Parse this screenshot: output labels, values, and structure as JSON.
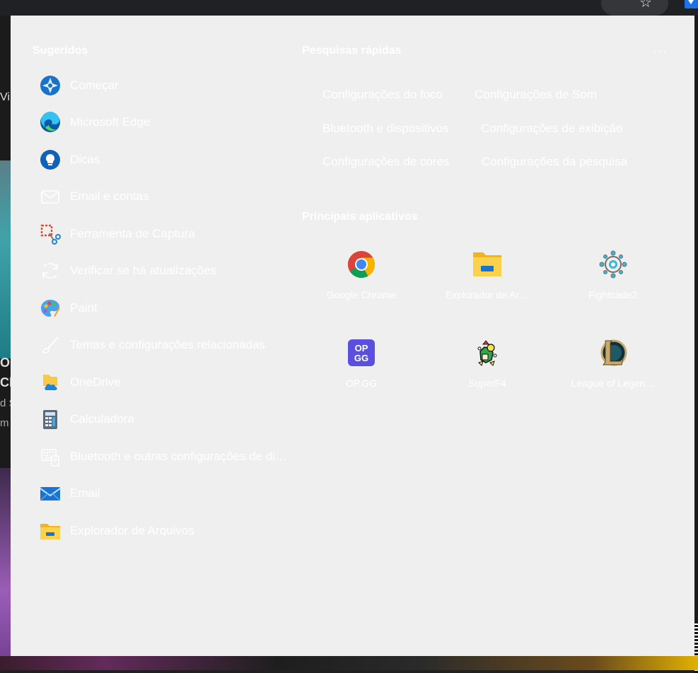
{
  "suggested": {
    "title": "Sugeridos",
    "items": [
      {
        "label": "Começar",
        "icon": "get-started-icon"
      },
      {
        "label": "Microsoft Edge",
        "icon": "edge-icon"
      },
      {
        "label": "Dicas",
        "icon": "tips-icon"
      },
      {
        "label": "Email e contas",
        "icon": "mail-outline-icon"
      },
      {
        "label": "Ferramenta de Captura",
        "icon": "snipping-tool-icon"
      },
      {
        "label": "Verificar se há atualizações",
        "icon": "refresh-icon"
      },
      {
        "label": "Paint",
        "icon": "paint-icon"
      },
      {
        "label": "Temas e configurações relacionadas",
        "icon": "brush-icon"
      },
      {
        "label": "OneDrive",
        "icon": "onedrive-icon"
      },
      {
        "label": "Calculadora",
        "icon": "calculator-icon"
      },
      {
        "label": "Bluetooth e outras configurações de di…",
        "icon": "devices-icon"
      },
      {
        "label": "Email",
        "icon": "mail-app-icon"
      },
      {
        "label": "Explorador de Arquivos",
        "icon": "folder-icon"
      }
    ]
  },
  "quick_searches": {
    "title": "Pesquisas rápidas",
    "items": [
      "Configurações do foco",
      "Configurações de Som",
      "Bluetooth e dispositivos",
      "Configurações de exibição",
      "Configurações de cores",
      "Configurações da pesquisa"
    ]
  },
  "top_apps": {
    "title": "Principais aplicativos",
    "items": [
      {
        "label": "Google Chrome",
        "icon": "chrome-icon"
      },
      {
        "label": "Explorador de Ar…",
        "icon": "folder-icon"
      },
      {
        "label": "Fightcade2",
        "icon": "fightcade-icon"
      },
      {
        "label": "OP.GG",
        "icon": "opgg-icon"
      },
      {
        "label": "SuperF4",
        "icon": "superf4-icon"
      },
      {
        "label": "League of Legen…",
        "icon": "league-icon"
      }
    ]
  },
  "more_label": "···",
  "opgg_logo": [
    "OP",
    "GG"
  ],
  "background_fragments": [
    "Vin",
    "Ou",
    "Cha",
    "d S",
    "m"
  ]
}
